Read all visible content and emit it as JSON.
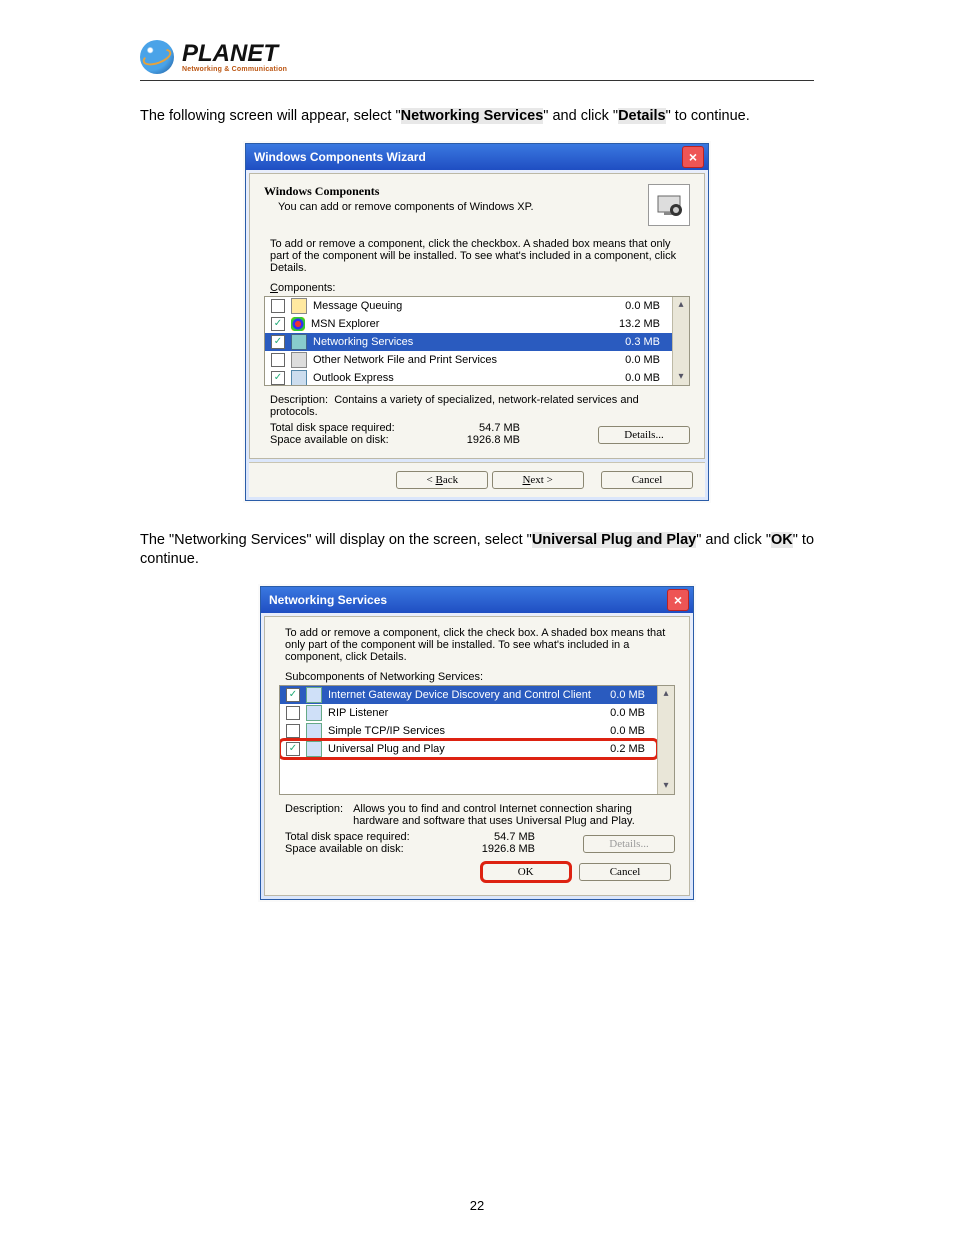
{
  "brand": {
    "name": "PLANET",
    "tagline": "Networking & Communication"
  },
  "para1": {
    "t1": "The following screen will appear, select \"",
    "b1": "Networking Services",
    "t2": "\" and click \"",
    "b2": "Details",
    "t3": "\" to continue."
  },
  "para2": {
    "t1": "The \"Networking Services\" will display on the screen, select \"",
    "b1": "Universal Plug and Play",
    "t2": "\" and click \"",
    "b2": "OK",
    "t3": "\" to continue."
  },
  "dlg1": {
    "title": "Windows Components Wizard",
    "heading": "Windows Components",
    "sub": "You can add or remove components of Windows XP.",
    "instr": "To add or remove a component, click the checkbox.  A shaded box means that only part of the component will be installed.  To see what's included in a component, click Details.",
    "componentsLabelPrefix": "C",
    "componentsLabelRest": "omponents:",
    "rows": [
      {
        "checked": false,
        "icon": "box",
        "label": "Message Queuing",
        "size": "0.0 MB",
        "sel": false
      },
      {
        "checked": true,
        "icon": "msn",
        "label": "MSN Explorer",
        "size": "13.2 MB",
        "sel": false
      },
      {
        "checked": true,
        "icon": "net",
        "label": "Networking Services",
        "size": "0.3 MB",
        "sel": true
      },
      {
        "checked": false,
        "icon": "prn",
        "label": "Other Network File and Print Services",
        "size": "0.0 MB",
        "sel": false
      },
      {
        "checked": true,
        "icon": "oe",
        "label": "Outlook Express",
        "size": "0.0 MB",
        "sel": false
      }
    ],
    "descLabel": "Description:",
    "descText": "Contains a variety of specialized, network-related services and protocols.",
    "disk1": {
      "l": "Total disk space required:",
      "v": "54.7 MB"
    },
    "disk2": {
      "l": "Space available on disk:",
      "v": "1926.8 MB"
    },
    "details": "Details...",
    "back": "< Back",
    "next": "Next >",
    "cancel": "Cancel"
  },
  "dlg2": {
    "title": "Networking Services",
    "instr": "To add or remove a component, click the check box. A shaded box means that only part of the component will be installed. To see what's included in a component, click Details.",
    "subLabelPrefix": "Subc",
    "subLabelRest": "omponents of Networking Services:",
    "rows": [
      {
        "checked": true,
        "icon": "srv",
        "label": "Internet Gateway Device Discovery and Control Client",
        "size": "0.0 MB",
        "sel": true,
        "red": false
      },
      {
        "checked": false,
        "icon": "srv",
        "label": "RIP Listener",
        "size": "0.0 MB",
        "sel": false,
        "red": false
      },
      {
        "checked": false,
        "icon": "srv",
        "label": "Simple TCP/IP Services",
        "size": "0.0 MB",
        "sel": false,
        "red": false
      },
      {
        "checked": true,
        "icon": "srv",
        "label": "Universal Plug and Play",
        "size": "0.2 MB",
        "sel": false,
        "red": true
      }
    ],
    "descLabel": "Description:",
    "descText": "Allows you to find and control Internet connection sharing hardware and software that uses Universal Plug and Play.",
    "disk1": {
      "l": "Total disk space required:",
      "v": "54.7 MB"
    },
    "disk2": {
      "l": "Space available on disk:",
      "v": "1926.8 MB"
    },
    "details": "Details...",
    "ok": "OK",
    "cancel": "Cancel"
  },
  "pageNumber": "22"
}
